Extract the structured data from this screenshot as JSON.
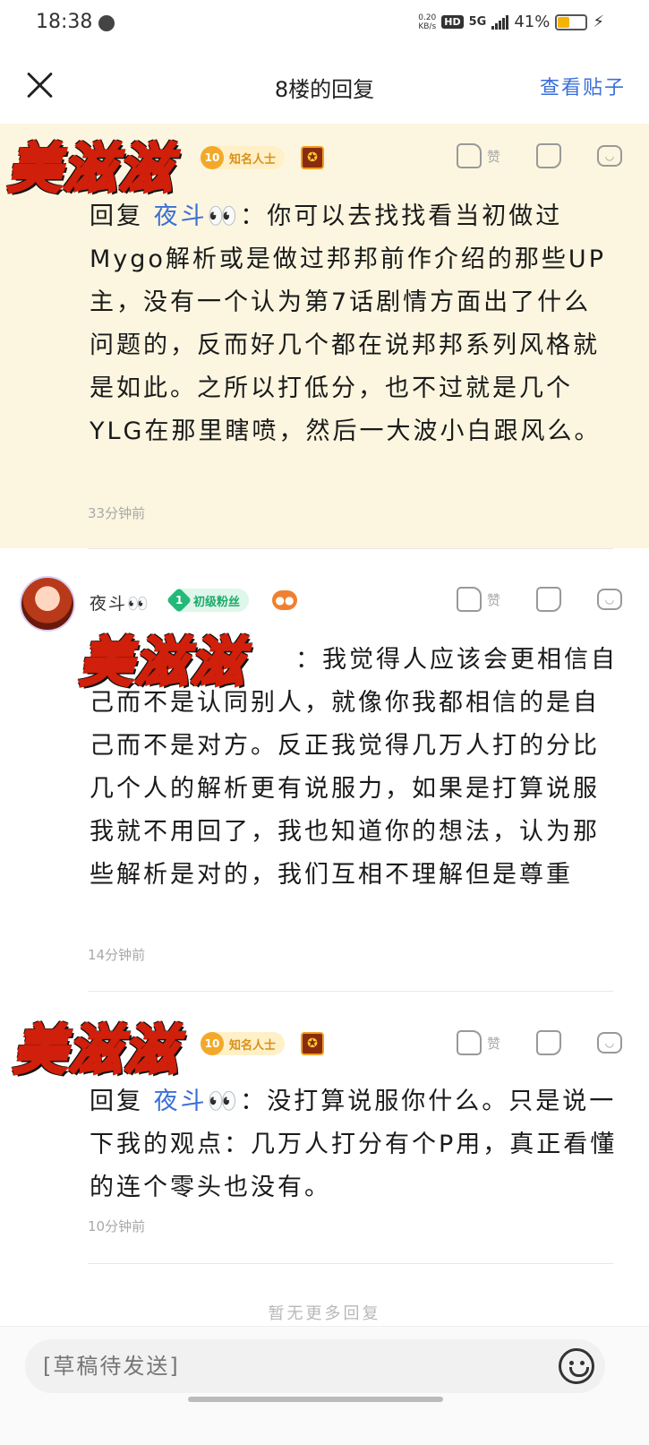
{
  "status": {
    "time": "18:38",
    "net_speed_top": "0.20",
    "net_speed_bottom": "KB/s",
    "hd": "HD",
    "network": "5G",
    "battery": "41%"
  },
  "header": {
    "title": "8楼的回复",
    "view_post": "查看贴子"
  },
  "replies": [
    {
      "nickname_art": "美滋滋",
      "level": "10",
      "badge": "知名人士",
      "like_label": "赞",
      "reply_prefix": "回复",
      "reply_to": "夜斗👀",
      "text": "：你可以去找找看当初做过Mygo解析或是做过邦邦前作介绍的那些UP主，没有一个认为第7话剧情方面出了什么问题的，反而好几个都在说邦邦系列风格就是如此。之所以打低分，也不过就是几个YLG在那里瞎喷，然后一大波小白跟风么。",
      "time": "33分钟前"
    },
    {
      "user_name": "夜斗👀",
      "level": "1",
      "badge": "初级粉丝",
      "like_label": "赞",
      "nickname_art": "美滋滋",
      "text": "：我觉得人应该会更相信自己而不是认同别人，就像你我都相信的是自己而不是对方。反正我觉得几万人打的分比几个人的解析更有说服力，如果是打算说服我就不用回了，我也知道你的想法，认为那些解析是对的，我们互相不理解但是尊重",
      "time": "14分钟前"
    },
    {
      "nickname_art": "美滋滋",
      "level": "10",
      "badge": "知名人士",
      "like_label": "赞",
      "reply_prefix": "回复",
      "reply_to": "夜斗👀",
      "text": "：没打算说服你什么。只是说一下我的观点：几万人打分有个P用，真正看懂的连个零头也没有。",
      "time": "10分钟前"
    }
  ],
  "footer": {
    "no_more": "暂无更多回复",
    "draft_placeholder": "[草稿待发送]"
  },
  "icons": [
    "close-icon",
    "thumb-up-icon",
    "thumb-down-icon",
    "comment-icon",
    "emoji-icon",
    "medal-icon",
    "gamepad-icon"
  ]
}
